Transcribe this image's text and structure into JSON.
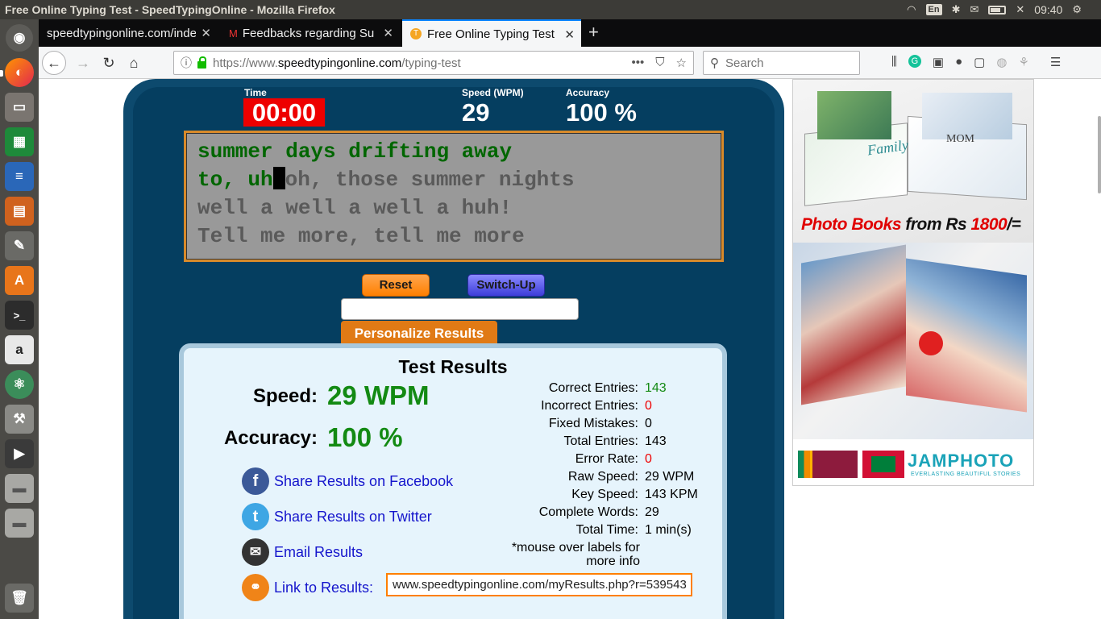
{
  "os": {
    "window_title": "Free Online Typing Test - SpeedTypingOnline - Mozilla Firefox",
    "keyboard_layout": "En",
    "clock": "09:40"
  },
  "browser": {
    "tabs": [
      {
        "label": "speedtypingonline.com/index",
        "active": false
      },
      {
        "label": "Feedbacks regarding Su",
        "active": false
      },
      {
        "label": "Free Online Typing Test",
        "active": true
      }
    ],
    "url_prefix": "https://www.",
    "url_domain": "speedtypingonline.com",
    "url_path": "/typing-test",
    "search_placeholder": "Search"
  },
  "test": {
    "time_label": "Time",
    "time_value": "00:00",
    "speed_label": "Speed (WPM)",
    "speed_value": "29",
    "accuracy_label": "Accuracy",
    "accuracy_value": "100 %",
    "lines": {
      "l1_typed": "summer days drifting away",
      "l2_typed": "to, uh",
      "l2_rest": "oh, those summer nights",
      "l3": "well a well a well a huh!",
      "l4": "Tell me more, tell me more"
    },
    "reset_label": "Reset",
    "switch_label": "Switch-Up",
    "personalize_label": "Personalize Results"
  },
  "results": {
    "title": "Test Results",
    "speed_label": "Speed:",
    "speed_value": "29 WPM",
    "accuracy_label": "Accuracy:",
    "accuracy_value": "100 %",
    "share_facebook": "Share Results on Facebook",
    "share_twitter": "Share Results on Twitter",
    "email": "Email Results",
    "link_label": "Link to Results:",
    "link_value": "www.speedtypingonline.com/myResults.php?r=539543",
    "stats": [
      {
        "k": "Correct Entries:",
        "v": "143",
        "color": "green"
      },
      {
        "k": "Incorrect Entries:",
        "v": "0",
        "color": "red"
      },
      {
        "k": "Fixed Mistakes:",
        "v": "0",
        "color": "black"
      },
      {
        "k": "Total Entries:",
        "v": "143",
        "color": "black"
      },
      {
        "k": "Error Rate:",
        "v": "0",
        "color": "red"
      },
      {
        "k": "Raw Speed:",
        "v": "29 WPM",
        "color": "black"
      },
      {
        "k": "Key Speed:",
        "v": "143 KPM",
        "color": "black"
      },
      {
        "k": "Complete Words:",
        "v": "29",
        "color": "black"
      },
      {
        "k": "Total Time:",
        "v": "1 min(s)",
        "color": "black"
      }
    ],
    "mouse_note": "*mouse over labels for more info"
  },
  "ad": {
    "caption_red1": "Photo Books",
    "caption_black": " from Rs ",
    "caption_red2": "1800",
    "caption_tail": "/=",
    "brand": "JAMPHOTO",
    "tagline": "EVERLASTING BEAUTIFUL STORIES",
    "book_title_family": "Family",
    "book_title_mom": "MOM"
  }
}
